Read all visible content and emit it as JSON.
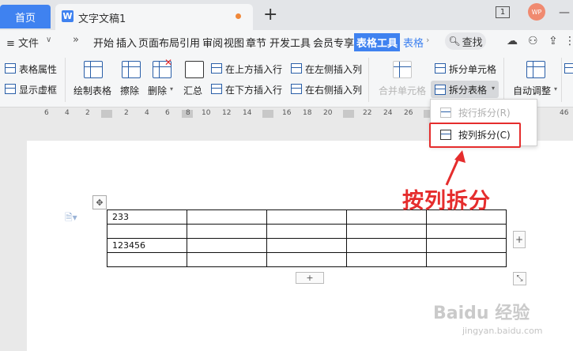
{
  "tabs": {
    "home": "首页",
    "document": "文字文稿1",
    "doc_icon": "W",
    "new_tab": "+"
  },
  "titlebar": {
    "badge": "1",
    "avatar": "WP",
    "minimize": "—"
  },
  "menu": {
    "hamburger": "≡ 文件",
    "more": "»",
    "items": [
      "开始",
      "插入",
      "页面布局",
      "引用",
      "审阅",
      "视图",
      "章节",
      "开发工具",
      "会员专享"
    ],
    "active_tab": "表格工具",
    "next_tab": "表格",
    "search": "查找"
  },
  "ribbon": {
    "table_props": "表格属性",
    "show_grid": "显示虚框",
    "draw_table": "绘制表格",
    "erase": "擦除",
    "delete": "删除",
    "summary": "汇总",
    "insert_above": "在上方插入行",
    "insert_below": "在下方插入行",
    "insert_left": "在左侧插入列",
    "insert_right": "在右侧插入列",
    "merge_cells": "合并单元格",
    "split_cells": "拆分单元格",
    "split_table": "拆分表格",
    "auto_adjust": "自动调整"
  },
  "ruler": [
    "6",
    "4",
    "2",
    "2",
    "4",
    "6",
    "8",
    "10",
    "12",
    "14",
    "16",
    "18",
    "20",
    "22",
    "24",
    "26",
    "28",
    "30",
    "32",
    "34",
    "46"
  ],
  "dropdown": {
    "split_by_row": "按行拆分(R)",
    "split_by_col": "按列拆分(C)"
  },
  "table": {
    "rows": [
      [
        "233",
        "",
        "",
        "",
        ""
      ],
      [
        "",
        "",
        "",
        "",
        ""
      ],
      [
        "123456",
        "",
        "",
        "",
        ""
      ],
      [
        "",
        "",
        "",
        "",
        ""
      ]
    ]
  },
  "annotation": "按列拆分",
  "watermark": {
    "main": "Baidu 经验",
    "sub": "jingyan.baidu.com"
  },
  "colors": {
    "accent": "#3f82f0",
    "highlight": "#e52d2d"
  }
}
